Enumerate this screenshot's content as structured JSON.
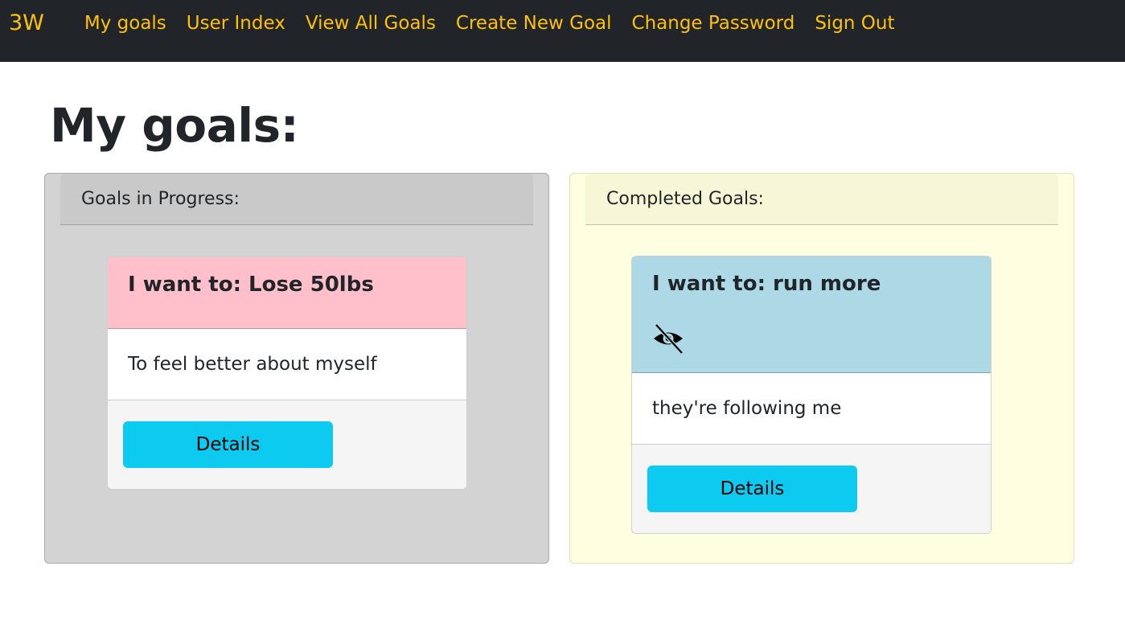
{
  "nav": {
    "brand": "3W",
    "links": [
      "My goals",
      "User Index",
      "View All Goals",
      "Create New Goal",
      "Change Password",
      "Sign Out"
    ]
  },
  "page": {
    "title": "My goals:"
  },
  "progress_panel": {
    "header": "Goals in Progress:",
    "goals": [
      {
        "title": "I want to: Lose 50lbs",
        "reason": "To feel better about myself",
        "button": "Details",
        "header_color": "#ffc0cb"
      }
    ]
  },
  "completed_panel": {
    "header": "Completed Goals:",
    "goals": [
      {
        "title": "I want to: run more",
        "reason": "they're following me",
        "button": "Details",
        "header_color": "#add8e6",
        "icon": "eye-slash-icon"
      }
    ]
  },
  "colors": {
    "navbar_bg": "#212529",
    "nav_text": "#ffc107",
    "progress_bg": "#d3d3d3",
    "completed_bg": "#fefee0",
    "button_bg": "#0dcaf0"
  }
}
